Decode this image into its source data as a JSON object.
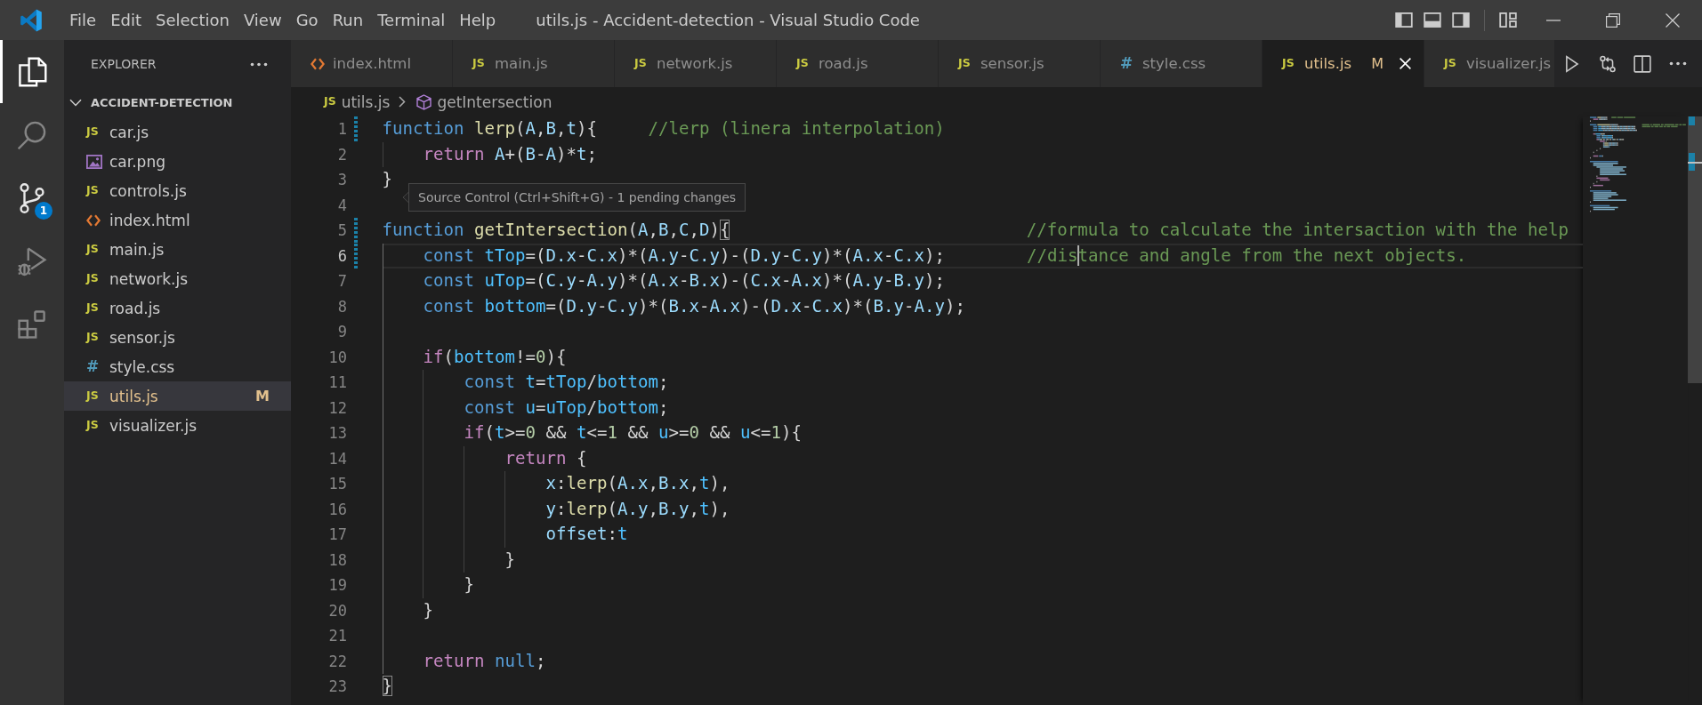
{
  "title_bar": {
    "menu": [
      "File",
      "Edit",
      "Selection",
      "View",
      "Go",
      "Run",
      "Terminal",
      "Help"
    ],
    "title": "utils.js - Accident-detection - Visual Studio Code"
  },
  "activity_bar": {
    "items": [
      {
        "kind": "explorer",
        "selected": true,
        "hovered": false
      },
      {
        "kind": "search",
        "selected": false,
        "hovered": false
      },
      {
        "kind": "source_control",
        "selected": false,
        "hovered": true,
        "badge": "1"
      },
      {
        "kind": "run_debug",
        "selected": false,
        "hovered": false
      },
      {
        "kind": "extensions",
        "selected": false,
        "hovered": false
      }
    ],
    "tooltip": "Source Control (Ctrl+Shift+G) - 1 pending changes"
  },
  "sidebar": {
    "title": "EXPLORER",
    "folder": {
      "name": "ACCIDENT-DETECTION",
      "expanded": true,
      "children": [
        {
          "name": "car.js",
          "kind": "js",
          "badge": "JS",
          "selected": false
        },
        {
          "name": "car.png",
          "kind": "image",
          "selected": false
        },
        {
          "name": "controls.js",
          "kind": "js",
          "badge": "JS",
          "selected": false
        },
        {
          "name": "index.html",
          "kind": "html",
          "selected": false
        },
        {
          "name": "main.js",
          "kind": "js",
          "badge": "JS",
          "selected": false
        },
        {
          "name": "network.js",
          "kind": "js",
          "badge": "JS",
          "selected": false
        },
        {
          "name": "road.js",
          "kind": "js",
          "badge": "JS",
          "selected": false
        },
        {
          "name": "sensor.js",
          "kind": "js",
          "badge": "JS",
          "selected": false
        },
        {
          "name": "style.css",
          "kind": "css",
          "badge": "#",
          "selected": false
        },
        {
          "name": "utils.js",
          "kind": "js",
          "badge": "JS",
          "selected": true,
          "git_status": "M"
        },
        {
          "name": "visualizer.js",
          "kind": "js",
          "badge": "JS",
          "selected": false
        }
      ]
    }
  },
  "tabs": [
    {
      "label": "index.html",
      "kind": "html",
      "selected": false
    },
    {
      "label": "main.js",
      "kind": "js",
      "badge": "JS",
      "selected": false
    },
    {
      "label": "network.js",
      "kind": "js",
      "badge": "JS",
      "selected": false
    },
    {
      "label": "road.js",
      "kind": "js",
      "badge": "JS",
      "selected": false
    },
    {
      "label": "sensor.js",
      "kind": "js",
      "badge": "JS",
      "selected": false
    },
    {
      "label": "style.css",
      "kind": "css",
      "badge": "#",
      "selected": false
    },
    {
      "label": "utils.js",
      "kind": "js",
      "badge": "JS",
      "selected": true,
      "git_status": "M"
    },
    {
      "label": "visualizer.js",
      "kind": "js",
      "badge": "JS",
      "selected": false
    }
  ],
  "breadcrumb": {
    "file": {
      "label": "utils.js",
      "kind": "js",
      "badge": "JS"
    },
    "symbol": "getIntersection"
  },
  "editor": {
    "lines": [
      {
        "number": "1",
        "modified": true,
        "current": false,
        "tokens": [
          {
            "kind": "keyword",
            "text": "function "
          },
          {
            "kind": "function",
            "text": "lerp"
          },
          {
            "kind": "plain",
            "text": "("
          },
          {
            "kind": "variable",
            "text": "A"
          },
          {
            "kind": "plain",
            "text": ","
          },
          {
            "kind": "variable",
            "text": "B"
          },
          {
            "kind": "plain",
            "text": ","
          },
          {
            "kind": "variable",
            "text": "t"
          },
          {
            "kind": "plain",
            "text": "){     "
          },
          {
            "kind": "comment",
            "text": "//lerp (linera interpolation)"
          }
        ],
        "children": [
          {
            "number": "2",
            "modified": false,
            "current": false,
            "tokens": [
              {
                "kind": "control",
                "text": "return "
              },
              {
                "kind": "variable",
                "text": "A"
              },
              {
                "kind": "plain",
                "text": "+("
              },
              {
                "kind": "variable",
                "text": "B"
              },
              {
                "kind": "plain",
                "text": "-"
              },
              {
                "kind": "variable",
                "text": "A"
              },
              {
                "kind": "plain",
                "text": ")*"
              },
              {
                "kind": "variable",
                "text": "t"
              },
              {
                "kind": "plain",
                "text": ";"
              }
            ]
          }
        ]
      },
      {
        "number": "3",
        "modified": false,
        "current": false,
        "tokens": [
          {
            "kind": "plain",
            "text": "}"
          }
        ]
      },
      {
        "number": "4",
        "modified": false,
        "current": false
      },
      {
        "number": "5",
        "modified": true,
        "current": false,
        "tokens": [
          {
            "kind": "keyword",
            "text": "function "
          },
          {
            "kind": "function",
            "text": "getIntersection"
          },
          {
            "kind": "plain",
            "text": "("
          },
          {
            "kind": "variable",
            "text": "A"
          },
          {
            "kind": "plain",
            "text": ","
          },
          {
            "kind": "variable",
            "text": "B"
          },
          {
            "kind": "plain",
            "text": ","
          },
          {
            "kind": "variable",
            "text": "C"
          },
          {
            "kind": "plain",
            "text": ","
          },
          {
            "kind": "variable",
            "text": "D"
          },
          {
            "kind": "plain",
            "text": ")"
          },
          {
            "kind": "matched_bracket",
            "text": "{"
          },
          {
            "kind": "comment",
            "text": "                             //formula to calculate the intersaction with the help"
          }
        ],
        "children": [
          {
            "number": "6",
            "modified": true,
            "current": true,
            "tokens": [
              {
                "kind": "keyword",
                "text": "const "
              },
              {
                "kind": "constant",
                "text": "tTop"
              },
              {
                "kind": "plain",
                "text": "=("
              },
              {
                "kind": "variable",
                "text": "D.x"
              },
              {
                "kind": "plain",
                "text": "-"
              },
              {
                "kind": "variable",
                "text": "C.x"
              },
              {
                "kind": "plain",
                "text": ")*("
              },
              {
                "kind": "variable",
                "text": "A.y"
              },
              {
                "kind": "plain",
                "text": "-"
              },
              {
                "kind": "variable",
                "text": "C.y"
              },
              {
                "kind": "plain",
                "text": ")-("
              },
              {
                "kind": "variable",
                "text": "D.y"
              },
              {
                "kind": "plain",
                "text": "-"
              },
              {
                "kind": "variable",
                "text": "C.y"
              },
              {
                "kind": "plain",
                "text": ")*("
              },
              {
                "kind": "variable",
                "text": "A.x"
              },
              {
                "kind": "plain",
                "text": "-"
              },
              {
                "kind": "variable",
                "text": "C.x"
              },
              {
                "kind": "plain",
                "text": ");        "
              },
              {
                "kind": "comment",
                "text": "//dis"
              },
              {
                "kind": "cursor"
              },
              {
                "kind": "comment",
                "text": "tance and angle from the next objects."
              }
            ]
          },
          {
            "number": "7",
            "modified": false,
            "current": false,
            "tokens": [
              {
                "kind": "keyword",
                "text": "const "
              },
              {
                "kind": "constant",
                "text": "uTop"
              },
              {
                "kind": "plain",
                "text": "=("
              },
              {
                "kind": "variable",
                "text": "C.y"
              },
              {
                "kind": "plain",
                "text": "-"
              },
              {
                "kind": "variable",
                "text": "A.y"
              },
              {
                "kind": "plain",
                "text": ")*("
              },
              {
                "kind": "variable",
                "text": "A.x"
              },
              {
                "kind": "plain",
                "text": "-"
              },
              {
                "kind": "variable",
                "text": "B.x"
              },
              {
                "kind": "plain",
                "text": ")-("
              },
              {
                "kind": "variable",
                "text": "C.x"
              },
              {
                "kind": "plain",
                "text": "-"
              },
              {
                "kind": "variable",
                "text": "A.x"
              },
              {
                "kind": "plain",
                "text": ")*("
              },
              {
                "kind": "variable",
                "text": "A.y"
              },
              {
                "kind": "plain",
                "text": "-"
              },
              {
                "kind": "variable",
                "text": "B.y"
              },
              {
                "kind": "plain",
                "text": ");"
              }
            ]
          },
          {
            "number": "8",
            "modified": false,
            "current": false,
            "tokens": [
              {
                "kind": "keyword",
                "text": "const "
              },
              {
                "kind": "constant",
                "text": "bottom"
              },
              {
                "kind": "plain",
                "text": "=("
              },
              {
                "kind": "variable",
                "text": "D.y"
              },
              {
                "kind": "plain",
                "text": "-"
              },
              {
                "kind": "variable",
                "text": "C.y"
              },
              {
                "kind": "plain",
                "text": ")*("
              },
              {
                "kind": "variable",
                "text": "B.x"
              },
              {
                "kind": "plain",
                "text": "-"
              },
              {
                "kind": "variable",
                "text": "A.x"
              },
              {
                "kind": "plain",
                "text": ")-("
              },
              {
                "kind": "variable",
                "text": "D.x"
              },
              {
                "kind": "plain",
                "text": "-"
              },
              {
                "kind": "variable",
                "text": "C.x"
              },
              {
                "kind": "plain",
                "text": ")*("
              },
              {
                "kind": "variable",
                "text": "B.y"
              },
              {
                "kind": "plain",
                "text": "-"
              },
              {
                "kind": "variable",
                "text": "A.y"
              },
              {
                "kind": "plain",
                "text": ");"
              }
            ]
          },
          {
            "number": "9",
            "modified": false,
            "current": false
          },
          {
            "number": "10",
            "modified": false,
            "current": false,
            "tokens": [
              {
                "kind": "control",
                "text": "if"
              },
              {
                "kind": "plain",
                "text": "("
              },
              {
                "kind": "constant",
                "text": "bottom"
              },
              {
                "kind": "plain",
                "text": "!="
              },
              {
                "kind": "number",
                "text": "0"
              },
              {
                "kind": "plain",
                "text": "){"
              }
            ],
            "children": [
              {
                "number": "11",
                "modified": false,
                "current": false,
                "tokens": [
                  {
                    "kind": "keyword",
                    "text": "const "
                  },
                  {
                    "kind": "constant",
                    "text": "t"
                  },
                  {
                    "kind": "plain",
                    "text": "="
                  },
                  {
                    "kind": "constant",
                    "text": "tTop"
                  },
                  {
                    "kind": "plain",
                    "text": "/"
                  },
                  {
                    "kind": "constant",
                    "text": "bottom"
                  },
                  {
                    "kind": "plain",
                    "text": ";"
                  }
                ]
              },
              {
                "number": "12",
                "modified": false,
                "current": false,
                "tokens": [
                  {
                    "kind": "keyword",
                    "text": "const "
                  },
                  {
                    "kind": "constant",
                    "text": "u"
                  },
                  {
                    "kind": "plain",
                    "text": "="
                  },
                  {
                    "kind": "constant",
                    "text": "uTop"
                  },
                  {
                    "kind": "plain",
                    "text": "/"
                  },
                  {
                    "kind": "constant",
                    "text": "bottom"
                  },
                  {
                    "kind": "plain",
                    "text": ";"
                  }
                ]
              },
              {
                "number": "13",
                "modified": false,
                "current": false,
                "tokens": [
                  {
                    "kind": "control",
                    "text": "if"
                  },
                  {
                    "kind": "plain",
                    "text": "("
                  },
                  {
                    "kind": "constant",
                    "text": "t"
                  },
                  {
                    "kind": "plain",
                    "text": ">="
                  },
                  {
                    "kind": "number",
                    "text": "0"
                  },
                  {
                    "kind": "plain",
                    "text": " && "
                  },
                  {
                    "kind": "constant",
                    "text": "t"
                  },
                  {
                    "kind": "plain",
                    "text": "<="
                  },
                  {
                    "kind": "number",
                    "text": "1"
                  },
                  {
                    "kind": "plain",
                    "text": " && "
                  },
                  {
                    "kind": "constant",
                    "text": "u"
                  },
                  {
                    "kind": "plain",
                    "text": ">="
                  },
                  {
                    "kind": "number",
                    "text": "0"
                  },
                  {
                    "kind": "plain",
                    "text": " && "
                  },
                  {
                    "kind": "constant",
                    "text": "u"
                  },
                  {
                    "kind": "plain",
                    "text": "<="
                  },
                  {
                    "kind": "number",
                    "text": "1"
                  },
                  {
                    "kind": "plain",
                    "text": "){"
                  }
                ],
                "children": [
                  {
                    "number": "14",
                    "modified": false,
                    "current": false,
                    "tokens": [
                      {
                        "kind": "control",
                        "text": "return"
                      },
                      {
                        "kind": "plain",
                        "text": " {"
                      }
                    ],
                    "children": [
                      {
                        "number": "15",
                        "modified": false,
                        "current": false,
                        "tokens": [
                          {
                            "kind": "variable",
                            "text": "x"
                          },
                          {
                            "kind": "plain",
                            "text": ":"
                          },
                          {
                            "kind": "function",
                            "text": "lerp"
                          },
                          {
                            "kind": "plain",
                            "text": "("
                          },
                          {
                            "kind": "variable",
                            "text": "A.x"
                          },
                          {
                            "kind": "plain",
                            "text": ","
                          },
                          {
                            "kind": "variable",
                            "text": "B.x"
                          },
                          {
                            "kind": "plain",
                            "text": ","
                          },
                          {
                            "kind": "constant",
                            "text": "t"
                          },
                          {
                            "kind": "plain",
                            "text": "),"
                          }
                        ]
                      },
                      {
                        "number": "16",
                        "modified": false,
                        "current": false,
                        "tokens": [
                          {
                            "kind": "variable",
                            "text": "y"
                          },
                          {
                            "kind": "plain",
                            "text": ":"
                          },
                          {
                            "kind": "function",
                            "text": "lerp"
                          },
                          {
                            "kind": "plain",
                            "text": "("
                          },
                          {
                            "kind": "variable",
                            "text": "A.y"
                          },
                          {
                            "kind": "plain",
                            "text": ","
                          },
                          {
                            "kind": "variable",
                            "text": "B.y"
                          },
                          {
                            "kind": "plain",
                            "text": ","
                          },
                          {
                            "kind": "constant",
                            "text": "t"
                          },
                          {
                            "kind": "plain",
                            "text": "),"
                          }
                        ]
                      },
                      {
                        "number": "17",
                        "modified": false,
                        "current": false,
                        "tokens": [
                          {
                            "kind": "variable",
                            "text": "offset"
                          },
                          {
                            "kind": "plain",
                            "text": ":"
                          },
                          {
                            "kind": "constant",
                            "text": "t"
                          }
                        ]
                      }
                    ]
                  },
                  {
                    "number": "18",
                    "modified": false,
                    "current": false,
                    "tokens": [
                      {
                        "kind": "plain",
                        "text": "}"
                      }
                    ]
                  }
                ]
              },
              {
                "number": "19",
                "modified": false,
                "current": false,
                "tokens": [
                  {
                    "kind": "plain",
                    "text": "}"
                  }
                ]
              }
            ]
          },
          {
            "number": "20",
            "modified": false,
            "current": false,
            "tokens": [
              {
                "kind": "plain",
                "text": "}"
              }
            ]
          },
          {
            "number": "21",
            "modified": false,
            "current": false
          },
          {
            "number": "22",
            "modified": false,
            "current": false,
            "tokens": [
              {
                "kind": "control",
                "text": "return "
              },
              {
                "kind": "keyword",
                "text": "null"
              },
              {
                "kind": "plain",
                "text": ";"
              }
            ]
          }
        ]
      },
      {
        "number": "23",
        "modified": false,
        "current": false,
        "tokens": [
          {
            "kind": "matched_bracket",
            "text": "}"
          }
        ]
      }
    ]
  }
}
